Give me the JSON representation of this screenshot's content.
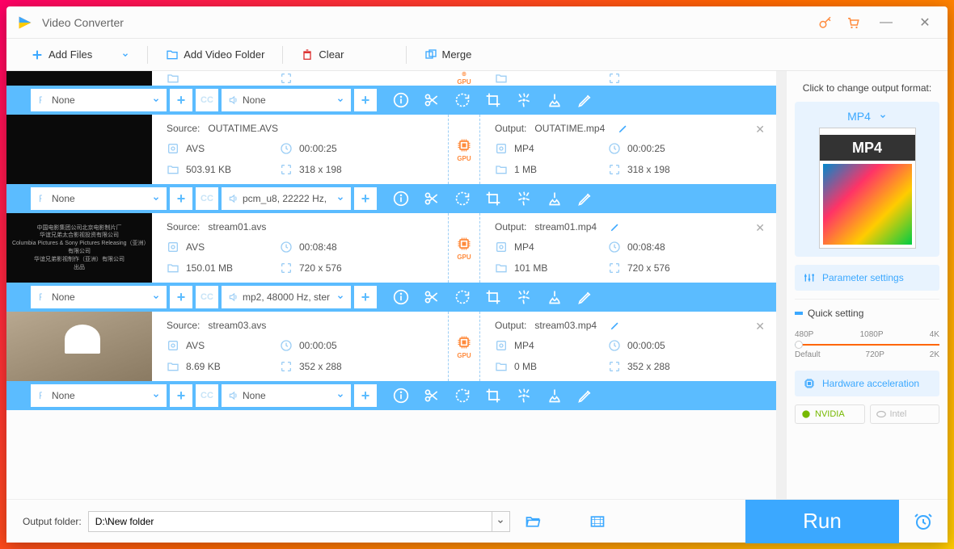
{
  "app": {
    "title": "Video Converter"
  },
  "toolbar": {
    "add_files": "Add Files",
    "add_folder": "Add Video Folder",
    "clear": "Clear",
    "merge": "Merge"
  },
  "items": [
    {
      "partial": true,
      "subtitle": "None",
      "audio": "None"
    },
    {
      "source_label": "Source: ",
      "source_name": "OUTATIME.AVS",
      "src_format": "AVS",
      "src_duration": "00:00:25",
      "src_size": "503.91 KB",
      "src_res": "318 x 198",
      "output_label": "Output: ",
      "output_name": "OUTATIME.mp4",
      "out_format": "MP4",
      "out_duration": "00:00:25",
      "out_size": "1 MB",
      "out_res": "318 x 198",
      "subtitle": "None",
      "audio": "pcm_u8, 22222 Hz,",
      "thumb_class": ""
    },
    {
      "source_label": "Source: ",
      "source_name": "stream01.avs",
      "src_format": "AVS",
      "src_duration": "00:08:48",
      "src_size": "150.01 MB",
      "src_res": "720 x 576",
      "output_label": "Output: ",
      "output_name": "stream01.mp4",
      "out_format": "MP4",
      "out_duration": "00:08:48",
      "out_size": "101 MB",
      "out_res": "720 x 576",
      "subtitle": "None",
      "audio": "mp2, 48000 Hz, ster",
      "thumb_text": "中国电影集团公司北京电影制片厂\n华谊兄弟太合影视投资有限公司\nColumbia Pictures & Sony Pictures Releasing（亚洲）有限公司\n华谊兄弟影视制作（亚洲）有限公司\n出品",
      "thumb_class": ""
    },
    {
      "source_label": "Source: ",
      "source_name": "stream03.avs",
      "src_format": "AVS",
      "src_duration": "00:00:05",
      "src_size": "8.69 KB",
      "src_res": "352 x 288",
      "output_label": "Output: ",
      "output_name": "stream03.mp4",
      "out_format": "MP4",
      "out_duration": "00:00:05",
      "out_size": "0 MB",
      "out_res": "352 x 288",
      "subtitle": "None",
      "audio": "None",
      "thumb_class": "thumb-vid"
    }
  ],
  "sidebar": {
    "change_format": "Click to change output format:",
    "format": "MP4",
    "format_badge": "MP4",
    "param_settings": "Parameter settings",
    "quick_setting": "Quick setting",
    "quality_top": [
      "480P",
      "1080P",
      "4K"
    ],
    "quality_bottom": [
      "Default",
      "720P",
      "2K"
    ],
    "hw_accel": "Hardware acceleration",
    "nvidia": "NVIDIA",
    "intel": "Intel"
  },
  "bottom": {
    "output_folder_label": "Output folder:",
    "output_folder_value": "D:\\New folder",
    "run": "Run"
  },
  "gpu_label": "GPU"
}
